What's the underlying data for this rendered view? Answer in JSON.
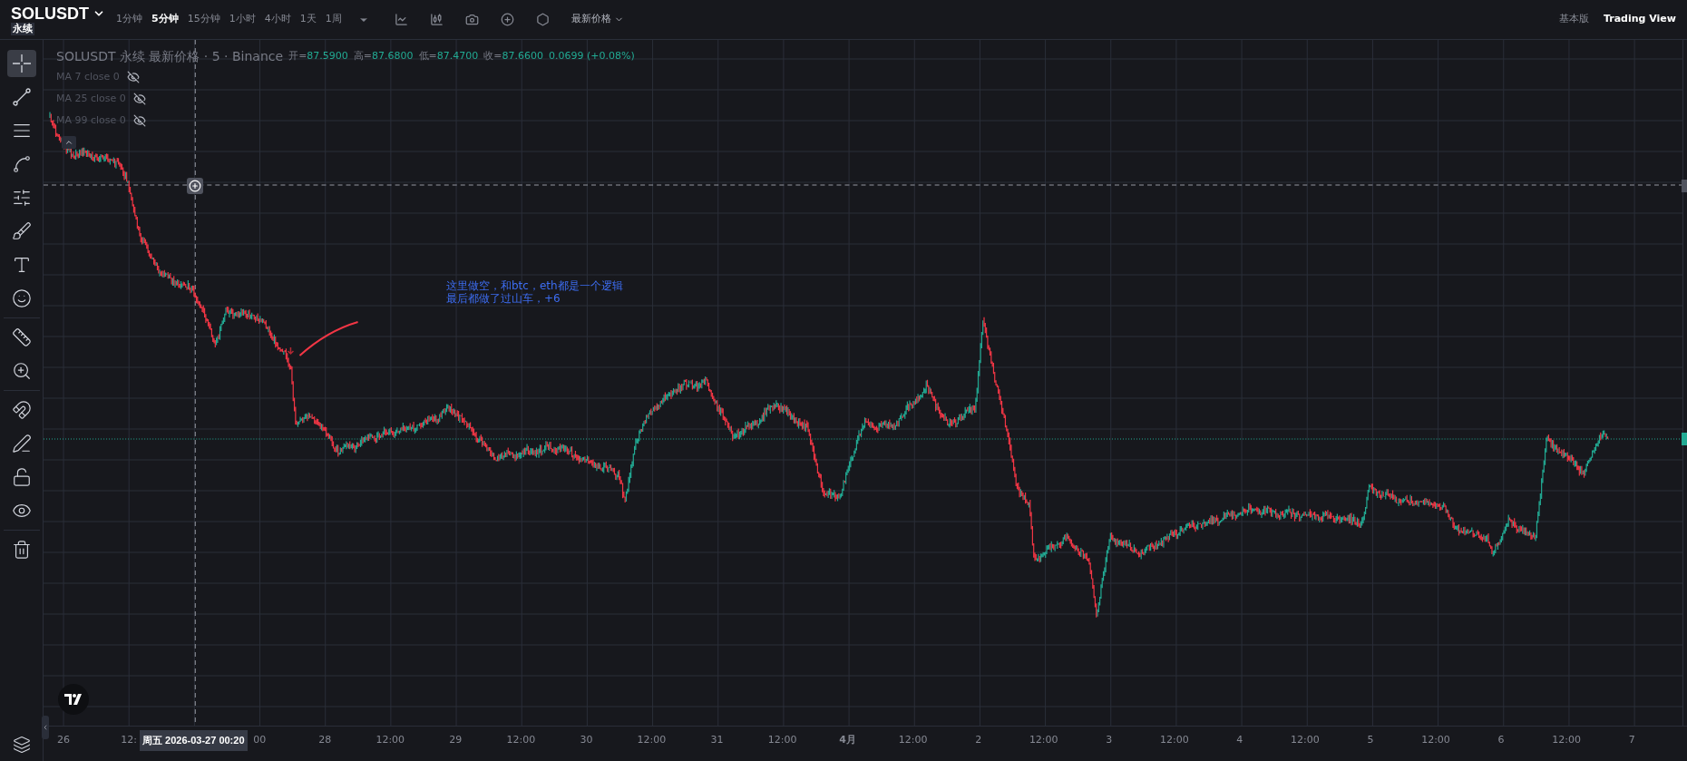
{
  "header": {
    "symbol": "SOLUSDT",
    "contract_badge": "永续",
    "intervals": [
      {
        "label": "1分钟",
        "selected": false
      },
      {
        "label": "5分钟",
        "selected": true
      },
      {
        "label": "15分钟",
        "selected": false
      },
      {
        "label": "1小时",
        "selected": false
      },
      {
        "label": "4小时",
        "selected": false
      },
      {
        "label": "1天",
        "selected": false
      },
      {
        "label": "1周",
        "selected": false
      }
    ],
    "price_type": "最新价格",
    "views": [
      {
        "label": "基本版",
        "selected": false
      },
      {
        "label": "Trading View",
        "selected": true
      }
    ]
  },
  "toolbar": {
    "groups": [
      [
        {
          "selected": true
        },
        {
          "selected": false
        },
        {
          "selected": false
        },
        {
          "selected": false
        },
        {
          "selected": false
        },
        {
          "selected": false
        },
        {
          "selected": false
        },
        {
          "selected": false
        }
      ],
      [
        {
          "selected": false
        },
        {
          "selected": false
        }
      ],
      [
        {
          "selected": false
        },
        {
          "selected": false
        },
        {
          "selected": false
        },
        {
          "selected": false
        }
      ],
      [
        {
          "selected": false
        }
      ]
    ]
  },
  "legend": {
    "title": "SOLUSDT 永续 最新价格 · 5 · Binance",
    "ohlc": [
      {
        "label": "开=",
        "value": "87.5900"
      },
      {
        "label": "高=",
        "value": "87.6800"
      },
      {
        "label": "低=",
        "value": "87.4700"
      },
      {
        "label": "收=",
        "value": "87.6600"
      }
    ],
    "change": "0.0699 (+0.08%)",
    "indicators": [
      {
        "label": "MA 7 close 0",
        "visible": false
      },
      {
        "label": "MA 25 close 0",
        "visible": false
      },
      {
        "label": "MA 99 close 0",
        "visible": false
      }
    ]
  },
  "annotation": {
    "lines": [
      "这里做空，和btc，eth都是一个逻辑",
      "最后都做了过山车，+6"
    ]
  },
  "time_axis": {
    "labels_before": [
      "26",
      "12:"
    ],
    "crosshair_label": "周五 2026-03-27   00:20",
    "labels_after": [
      "00",
      "28",
      "12:00",
      "29",
      "12:00",
      "30",
      "12:00",
      "31",
      "12:00",
      "4月",
      "12:00",
      "2",
      "12:00",
      "3",
      "12:00",
      "4",
      "12:00",
      "5",
      "12:00",
      "6",
      "12:00",
      "7"
    ]
  }
}
